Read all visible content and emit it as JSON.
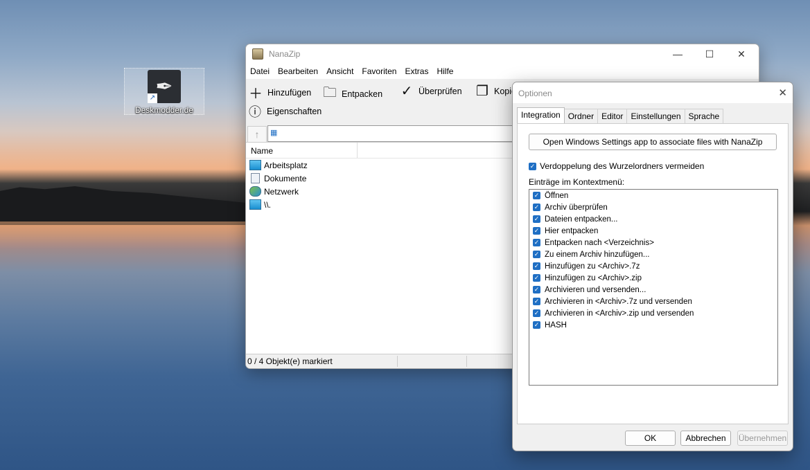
{
  "desktop": {
    "icon_label": "Deskmodder.de"
  },
  "nanazip": {
    "title": "NanaZip",
    "menu": [
      "Datei",
      "Bearbeiten",
      "Ansicht",
      "Favoriten",
      "Extras",
      "Hilfe"
    ],
    "toolbar": {
      "add": "Hinzufügen",
      "extract": "Entpacken",
      "test": "Überprüfen",
      "copy": "Kopie",
      "properties": "Eigenschaften"
    },
    "columns": {
      "name": "Name"
    },
    "files": [
      {
        "name": "Arbeitsplatz",
        "icon": "computer-icon"
      },
      {
        "name": "Dokumente",
        "icon": "document-icon"
      },
      {
        "name": "Netzwerk",
        "icon": "network-icon"
      },
      {
        "name": "\\\\.",
        "icon": "computer-icon"
      }
    ],
    "status": "0 / 4 Objekt(e) markiert"
  },
  "options": {
    "title": "Optionen",
    "tabs": [
      "Integration",
      "Ordner",
      "Editor",
      "Einstellungen",
      "Sprache"
    ],
    "active_tab": "Integration",
    "open_settings_button": "Open Windows Settings app to associate files with NanaZip",
    "avoid_root_duplication": "Verdoppelung des Wurzelordners vermeiden",
    "context_menu_label": "Einträge im Kontextmenü:",
    "context_items": [
      "Öffnen",
      "Archiv überprüfen",
      "Dateien entpacken...",
      "Hier entpacken",
      "Entpacken nach <Verzeichnis>",
      "Zu einem Archiv hinzufügen...",
      "Hinzufügen zu <Archiv>.7z",
      "Hinzufügen zu <Archiv>.zip",
      "Archivieren und versenden...",
      "Archivieren in <Archiv>.7z und versenden",
      "Archivieren in <Archiv>.zip und versenden",
      "HASH"
    ],
    "buttons": {
      "ok": "OK",
      "cancel": "Abbrechen",
      "apply": "Übernehmen"
    },
    "accent_color": "#1f6fc4"
  }
}
